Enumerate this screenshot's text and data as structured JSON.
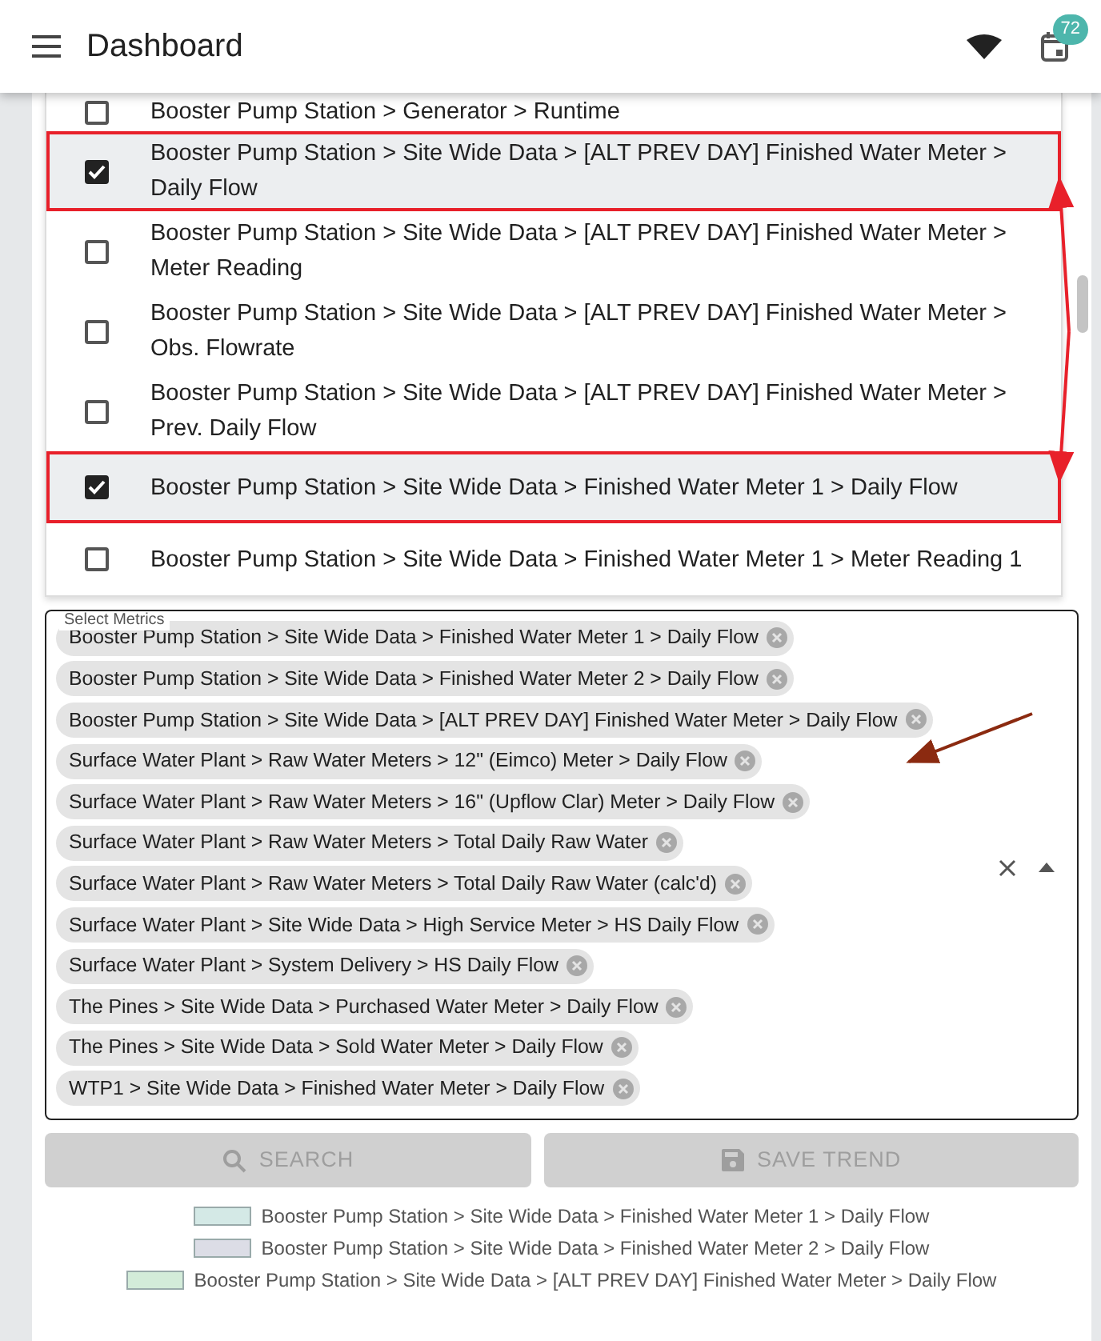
{
  "header": {
    "title": "Dashboard",
    "badge": "72"
  },
  "options": [
    {
      "label": "Booster Pump Station > Generator > Runtime",
      "checked": false,
      "highlighted": false
    },
    {
      "label": "Booster Pump Station > Site Wide Data > [ALT PREV DAY] Finished Water Meter > Daily Flow",
      "checked": true,
      "highlighted": true
    },
    {
      "label": "Booster Pump Station > Site Wide Data > [ALT PREV DAY] Finished Water Meter > Meter Reading",
      "checked": false,
      "highlighted": false
    },
    {
      "label": "Booster Pump Station > Site Wide Data > [ALT PREV DAY] Finished Water Meter > Obs. Flowrate",
      "checked": false,
      "highlighted": false
    },
    {
      "label": "Booster Pump Station > Site Wide Data > [ALT PREV DAY] Finished Water Meter > Prev. Daily Flow",
      "checked": false,
      "highlighted": false
    },
    {
      "label": "Booster Pump Station > Site Wide Data > Finished Water Meter 1 > Daily Flow",
      "checked": true,
      "highlighted": true
    },
    {
      "label": "Booster Pump Station > Site Wide Data > Finished Water Meter 1 > Meter Reading 1",
      "checked": false,
      "highlighted": false
    }
  ],
  "metrics_field": {
    "label": "Select Metrics",
    "chips": [
      "Booster Pump Station > Site Wide Data > Finished Water Meter 1 > Daily Flow",
      "Booster Pump Station > Site Wide Data > Finished Water Meter 2 > Daily Flow",
      "Booster Pump Station > Site Wide Data > [ALT PREV DAY] Finished Water Meter > Daily Flow",
      "Surface Water Plant > Raw Water Meters > 12\" (Eimco) Meter > Daily Flow",
      "Surface Water Plant > Raw Water Meters > 16\" (Upflow Clar) Meter > Daily Flow",
      "Surface Water Plant > Raw Water Meters > Total Daily Raw Water",
      "Surface Water Plant > Raw Water Meters > Total Daily Raw Water (calc'd)",
      "Surface Water Plant > Site Wide Data > High Service Meter > HS Daily Flow",
      "Surface Water Plant > System Delivery > HS Daily Flow",
      "The Pines > Site Wide Data > Purchased Water Meter > Daily Flow",
      "The Pines > Site Wide Data > Sold Water Meter > Daily Flow",
      "WTP1 > Site Wide Data > Finished Water Meter > Daily Flow"
    ]
  },
  "buttons": [
    {
      "kind": "search",
      "label": "SEARCH",
      "disabled": true
    },
    {
      "kind": "save",
      "label": "SAVE TREND",
      "disabled": true
    }
  ],
  "legend": [
    {
      "label": "Booster Pump Station > Site Wide Data > Finished Water Meter 1 > Daily Flow",
      "color": "#d4e9e6"
    },
    {
      "label": "Booster Pump Station > Site Wide Data > Finished Water Meter 2 > Daily Flow",
      "color": "#dcdde6"
    },
    {
      "label": "Booster Pump Station > Site Wide Data > [ALT PREV DAY] Finished Water Meter > Daily Flow",
      "color": "#d3ecd9"
    }
  ]
}
